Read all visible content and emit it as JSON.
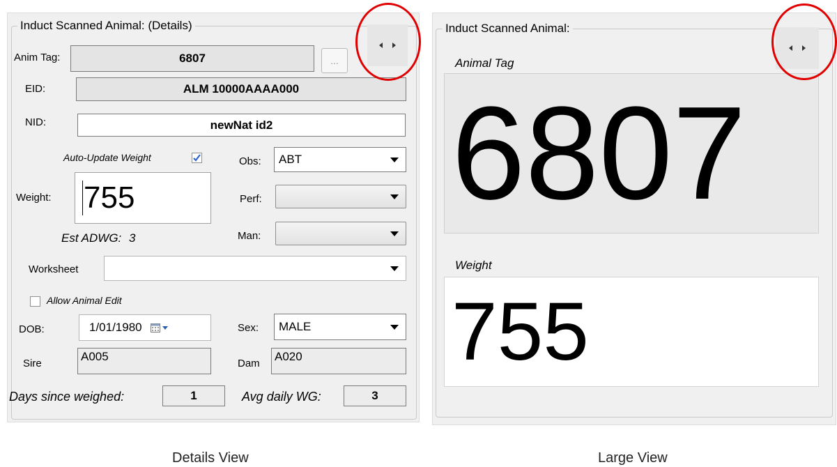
{
  "details": {
    "group_title": "Induct Scanned Animal: (Details)",
    "anim_tag_label": "Anim Tag:",
    "anim_tag_value": "6807",
    "browse_label": "...",
    "eid_label": "EID:",
    "eid_value": "ALM 10000AAAA000",
    "nid_label": "NID:",
    "nid_value": "newNat id2",
    "auto_update_label": "Auto-Update Weight",
    "auto_update_checked": true,
    "weight_label": "Weight:",
    "weight_value": "755",
    "est_adwg_label": "Est ADWG:",
    "est_adwg_value": "3",
    "obs_label": "Obs:",
    "obs_value": "ABT",
    "perf_label": "Perf:",
    "perf_value": "",
    "man_label": "Man:",
    "man_value": "",
    "worksheet_label": "Worksheet",
    "worksheet_value": "",
    "allow_edit_label": "Allow Animal Edit",
    "allow_edit_checked": false,
    "dob_label": "DOB:",
    "dob_value": "1/01/1980",
    "sex_label": "Sex:",
    "sex_value": "MALE",
    "sire_label": "Sire",
    "sire_value": "A005",
    "dam_label": "Dam",
    "dam_value": "A020",
    "days_since_label": "Days since weighed:",
    "days_since_value": "1",
    "avg_daily_label": "Avg daily WG:",
    "avg_daily_value": "3",
    "caption": "Details View"
  },
  "large": {
    "group_title": "Induct Scanned Animal:",
    "animal_tag_label": "Animal Tag",
    "animal_tag_value": "6807",
    "weight_label": "Weight",
    "weight_value": "755",
    "caption": "Large View"
  },
  "colors": {
    "highlight_circle": "#e00000",
    "checkbox_check": "#2b63c9"
  }
}
